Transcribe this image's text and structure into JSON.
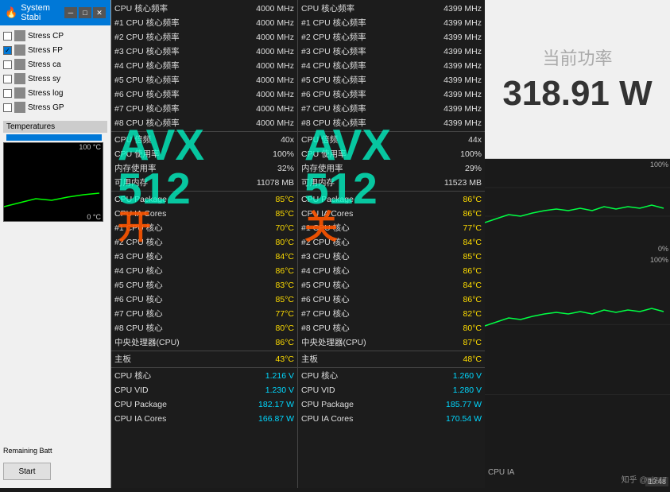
{
  "window": {
    "title": "System Stabi",
    "flame": "🔥"
  },
  "sidebar": {
    "stressItems": [
      {
        "label": "Stress CP",
        "checked": false,
        "icon": "cpu-icon"
      },
      {
        "label": "Stress FP",
        "checked": true,
        "icon": "fpu-icon"
      },
      {
        "label": "Stress ca",
        "checked": false,
        "icon": "cache-icon"
      },
      {
        "label": "Stress sy",
        "checked": false,
        "icon": "sys-icon"
      },
      {
        "label": "Stress log",
        "checked": false,
        "icon": "log-icon"
      },
      {
        "label": "Stress GP",
        "checked": false,
        "icon": "gpu-icon"
      }
    ],
    "temperaturesLabel": "Temperatures",
    "temp100": "100 °C",
    "temp0": "0 °C",
    "remainingBatt": "Remaining Batt",
    "startButton": "Start"
  },
  "leftColumn": {
    "rows": [
      {
        "label": "CPU 核心频率",
        "value": "4000 MHz"
      },
      {
        "label": "#1 CPU 核心频率",
        "value": "4000 MHz"
      },
      {
        "label": "#2 CPU 核心频率",
        "value": "4000 MHz"
      },
      {
        "label": "#3 CPU 核心频率",
        "value": "4000 MHz"
      },
      {
        "label": "#4 CPU 核心频率",
        "value": "4000 MHz"
      },
      {
        "label": "#5 CPU 核心频率",
        "value": "4000 MHz"
      },
      {
        "label": "#6 CPU 核心频率",
        "value": "4000 MHz"
      },
      {
        "label": "#7 CPU 核心频率",
        "value": "4000 MHz"
      },
      {
        "label": "#8 CPU 核心频率",
        "value": "4000 MHz"
      },
      {
        "label": "CPU 倍频",
        "value": "40x"
      },
      {
        "label": "CPU 使用率",
        "value": "100%"
      },
      {
        "label": "内存使用率",
        "value": "32%"
      },
      {
        "label": "可用内存",
        "value": "11078 MB"
      },
      {
        "label": "CPU Package",
        "value": "85°C",
        "color": "yellow"
      },
      {
        "label": "CPU IA Cores",
        "value": "85°C",
        "color": "yellow"
      },
      {
        "label": "#1 CPU 核心",
        "value": "70°C",
        "color": "yellow"
      },
      {
        "label": "#2 CPU 核心",
        "value": "80°C",
        "color": "yellow"
      },
      {
        "label": "#3 CPU 核心",
        "value": "84°C",
        "color": "yellow"
      },
      {
        "label": "#4 CPU 核心",
        "value": "86°C",
        "color": "yellow"
      },
      {
        "label": "#5 CPU 核心",
        "value": "83°C",
        "color": "yellow"
      },
      {
        "label": "#6 CPU 核心",
        "value": "85°C",
        "color": "yellow"
      },
      {
        "label": "#7 CPU 核心",
        "value": "77°C",
        "color": "yellow"
      },
      {
        "label": "#8 CPU 核心",
        "value": "80°C",
        "color": "yellow"
      },
      {
        "label": "中央处理器(CPU)",
        "value": "86°C",
        "color": "yellow"
      },
      {
        "label": "主板",
        "value": "43°C",
        "color": "yellow"
      },
      {
        "label": "CPU 核心",
        "value": "1.216 V",
        "color": "cyan"
      },
      {
        "label": "CPU VID",
        "value": "1.230 V",
        "color": "cyan"
      },
      {
        "label": "CPU Package",
        "value": "182.17 W",
        "color": "cyan"
      },
      {
        "label": "CPU IA Cores",
        "value": "166.87 W",
        "color": "cyan"
      }
    ]
  },
  "rightColumn": {
    "rows": [
      {
        "label": "CPU 核心频率",
        "value": "4399 MHz"
      },
      {
        "label": "#1 CPU 核心频率",
        "value": "4399 MHz"
      },
      {
        "label": "#2 CPU 核心频率",
        "value": "4399 MHz"
      },
      {
        "label": "#3 CPU 核心频率",
        "value": "4399 MHz"
      },
      {
        "label": "#4 CPU 核心频率",
        "value": "4399 MHz"
      },
      {
        "label": "#5 CPU 核心频率",
        "value": "4399 MHz"
      },
      {
        "label": "#6 CPU 核心频率",
        "value": "4399 MHz"
      },
      {
        "label": "#7 CPU 核心频率",
        "value": "4399 MHz"
      },
      {
        "label": "#8 CPU 核心频率",
        "value": "4399 MHz"
      },
      {
        "label": "CPU 倍频",
        "value": "44x"
      },
      {
        "label": "CPU 使用率",
        "value": "100%"
      },
      {
        "label": "内存使用率",
        "value": "29%"
      },
      {
        "label": "可用内存",
        "value": "11523 MB"
      },
      {
        "label": "CPU Package",
        "value": "86°C",
        "color": "yellow"
      },
      {
        "label": "CPU IA Cores",
        "value": "86°C",
        "color": "yellow"
      },
      {
        "label": "#1 CPU 核心",
        "value": "77°C",
        "color": "yellow"
      },
      {
        "label": "#2 CPU 核心",
        "value": "84°C",
        "color": "yellow"
      },
      {
        "label": "#3 CPU 核心",
        "value": "85°C",
        "color": "yellow"
      },
      {
        "label": "#4 CPU 核心",
        "value": "86°C",
        "color": "yellow"
      },
      {
        "label": "#5 CPU 核心",
        "value": "84°C",
        "color": "yellow"
      },
      {
        "label": "#6 CPU 核心",
        "value": "86°C",
        "color": "yellow"
      },
      {
        "label": "#7 CPU 核心",
        "value": "82°C",
        "color": "yellow"
      },
      {
        "label": "#8 CPU 核心",
        "value": "80°C",
        "color": "yellow"
      },
      {
        "label": "中央处理器(CPU)",
        "value": "87°C",
        "color": "yellow"
      },
      {
        "label": "主板",
        "value": "48°C",
        "color": "yellow"
      },
      {
        "label": "CPU 核心",
        "value": "1.260 V",
        "color": "cyan"
      },
      {
        "label": "CPU VID",
        "value": "1.280 V",
        "color": "cyan"
      },
      {
        "label": "CPU Package",
        "value": "185.77 W",
        "color": "cyan"
      },
      {
        "label": "CPU IA Cores",
        "value": "170.54 W",
        "color": "cyan"
      }
    ]
  },
  "rightPanel": {
    "powerLabel": "当前功率",
    "powerValue": "318.91 W"
  },
  "avx": {
    "left": {
      "avx": "AVX",
      "num": "512",
      "state": "开"
    },
    "right": {
      "avx": "AVX",
      "num": "512",
      "state": "关"
    }
  },
  "graph": {
    "label100": "100%",
    "label0": "0%",
    "timestamp": "10:48",
    "watermark": "知乎 @pj247",
    "cpuIA": "CPU IA"
  }
}
